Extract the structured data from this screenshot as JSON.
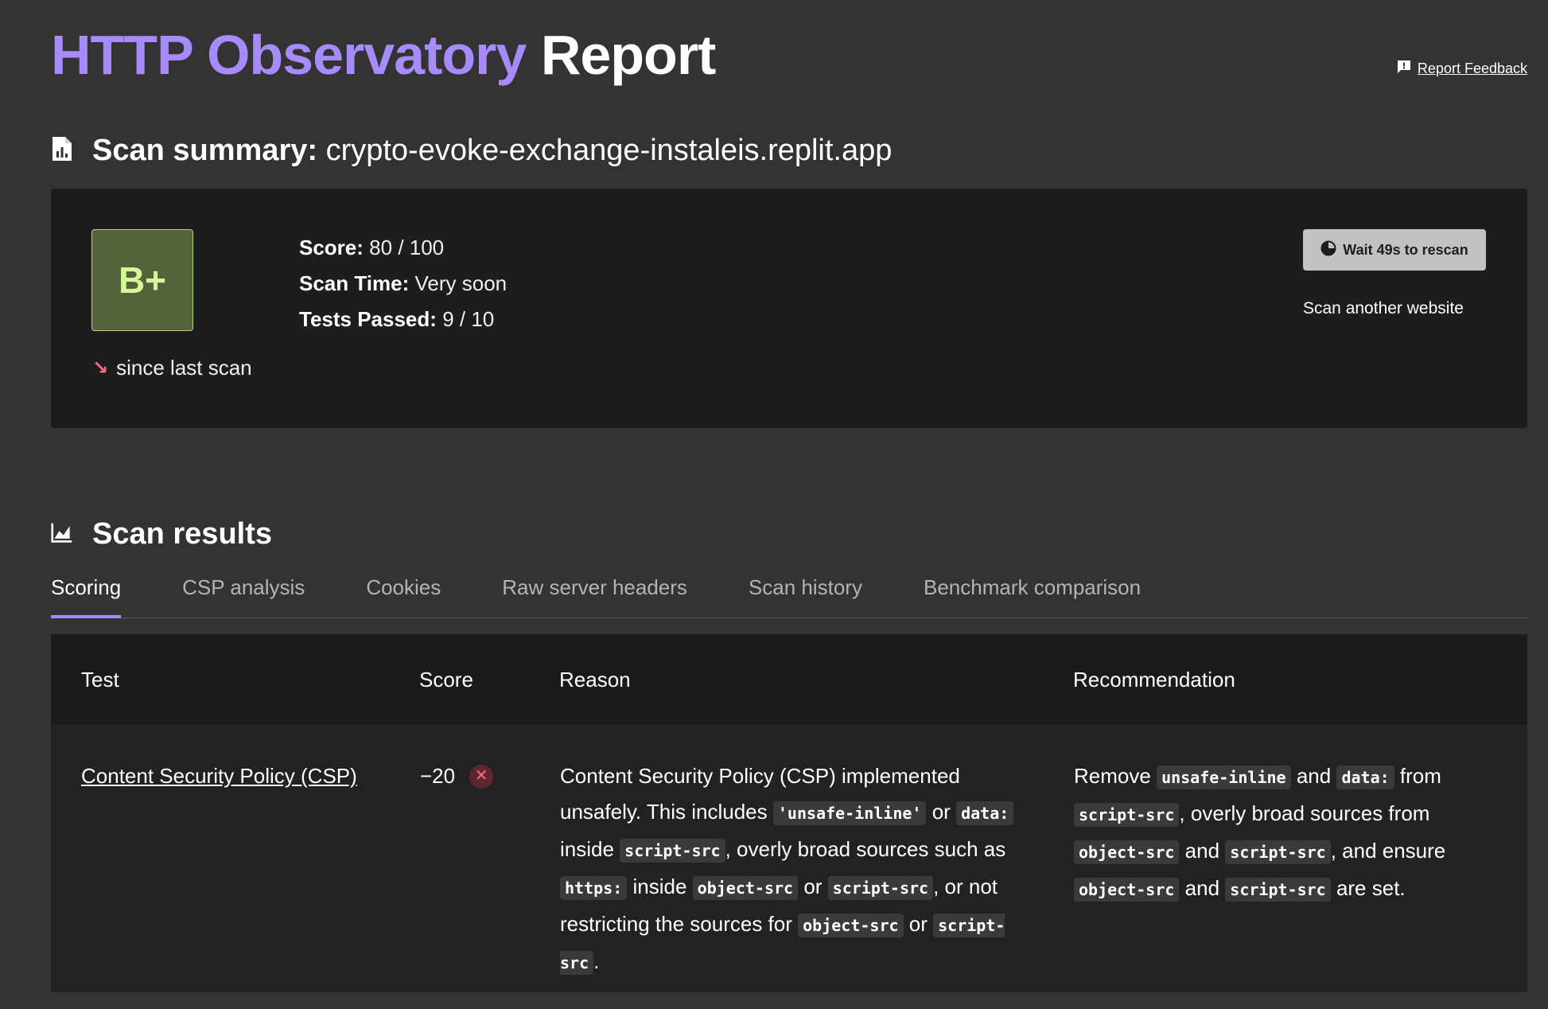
{
  "header": {
    "title_accent": "HTTP Observatory",
    "title_plain": "Report",
    "feedback_label": "Report Feedback"
  },
  "summary": {
    "heading_label": "Scan summary:",
    "host": "crypto-evoke-exchange-instaleis.replit.app",
    "grade": "B+",
    "trend_label": "since last scan",
    "score_label": "Score",
    "score_value": "80 / 100",
    "scan_time_label": "Scan Time",
    "scan_time_value": "Very soon",
    "tests_passed_label": "Tests Passed",
    "tests_passed_value": "9 / 10",
    "rescan_label": "Wait 49s to rescan",
    "scan_another_label": "Scan another website"
  },
  "results": {
    "heading": "Scan results",
    "tabs": [
      {
        "label": "Scoring",
        "active": true
      },
      {
        "label": "CSP analysis",
        "active": false
      },
      {
        "label": "Cookies",
        "active": false
      },
      {
        "label": "Raw server headers",
        "active": false
      },
      {
        "label": "Scan history",
        "active": false
      },
      {
        "label": "Benchmark comparison",
        "active": false
      }
    ],
    "columns": [
      "Test",
      "Score",
      "Reason",
      "Recommendation"
    ],
    "rows": [
      {
        "test": "Content Security Policy (CSP)",
        "score": "−20",
        "status": "fail",
        "reason": {
          "t1": "Content Security Policy (CSP) implemented unsafely. This includes",
          "c1": "'unsafe-inline'",
          "t2": "or",
          "c2": "data:",
          "t3": "inside",
          "c3": "script-src",
          "t4": ", overly broad sources such as",
          "c4": "https:",
          "t5": "inside",
          "c5": "object-src",
          "t6": "or",
          "c6": "script-src",
          "t7": ", or not restricting the sources for",
          "c7": "object-src",
          "t8": "or",
          "c8": "script-src",
          "t9": "."
        },
        "recommendation": {
          "t1": "Remove",
          "c1": "unsafe-inline",
          "t2": "and",
          "c2": "data:",
          "t3": "from",
          "c3": "script-src",
          "t4": ", overly broad sources from",
          "c4": "object-src",
          "t5": "and",
          "c5": "script-src",
          "t6": ", and ensure",
          "c6": "object-src",
          "t7": "and",
          "c7": "script-src",
          "t8": "are set."
        }
      }
    ]
  },
  "colors": {
    "background": "#333333",
    "card": "#1d1d1d",
    "accent": "#a78bfa",
    "grade_bg": "#55633a",
    "grade_text": "#d7f59a",
    "fail": "#ff6b81"
  },
  "icons": {
    "feedback": "feedback-icon",
    "summary": "report-document-icon",
    "results": "chart-icon",
    "rescan": "timer-pie-icon",
    "trend": "arrow-down-right-icon",
    "fail": "close-circle-icon"
  }
}
